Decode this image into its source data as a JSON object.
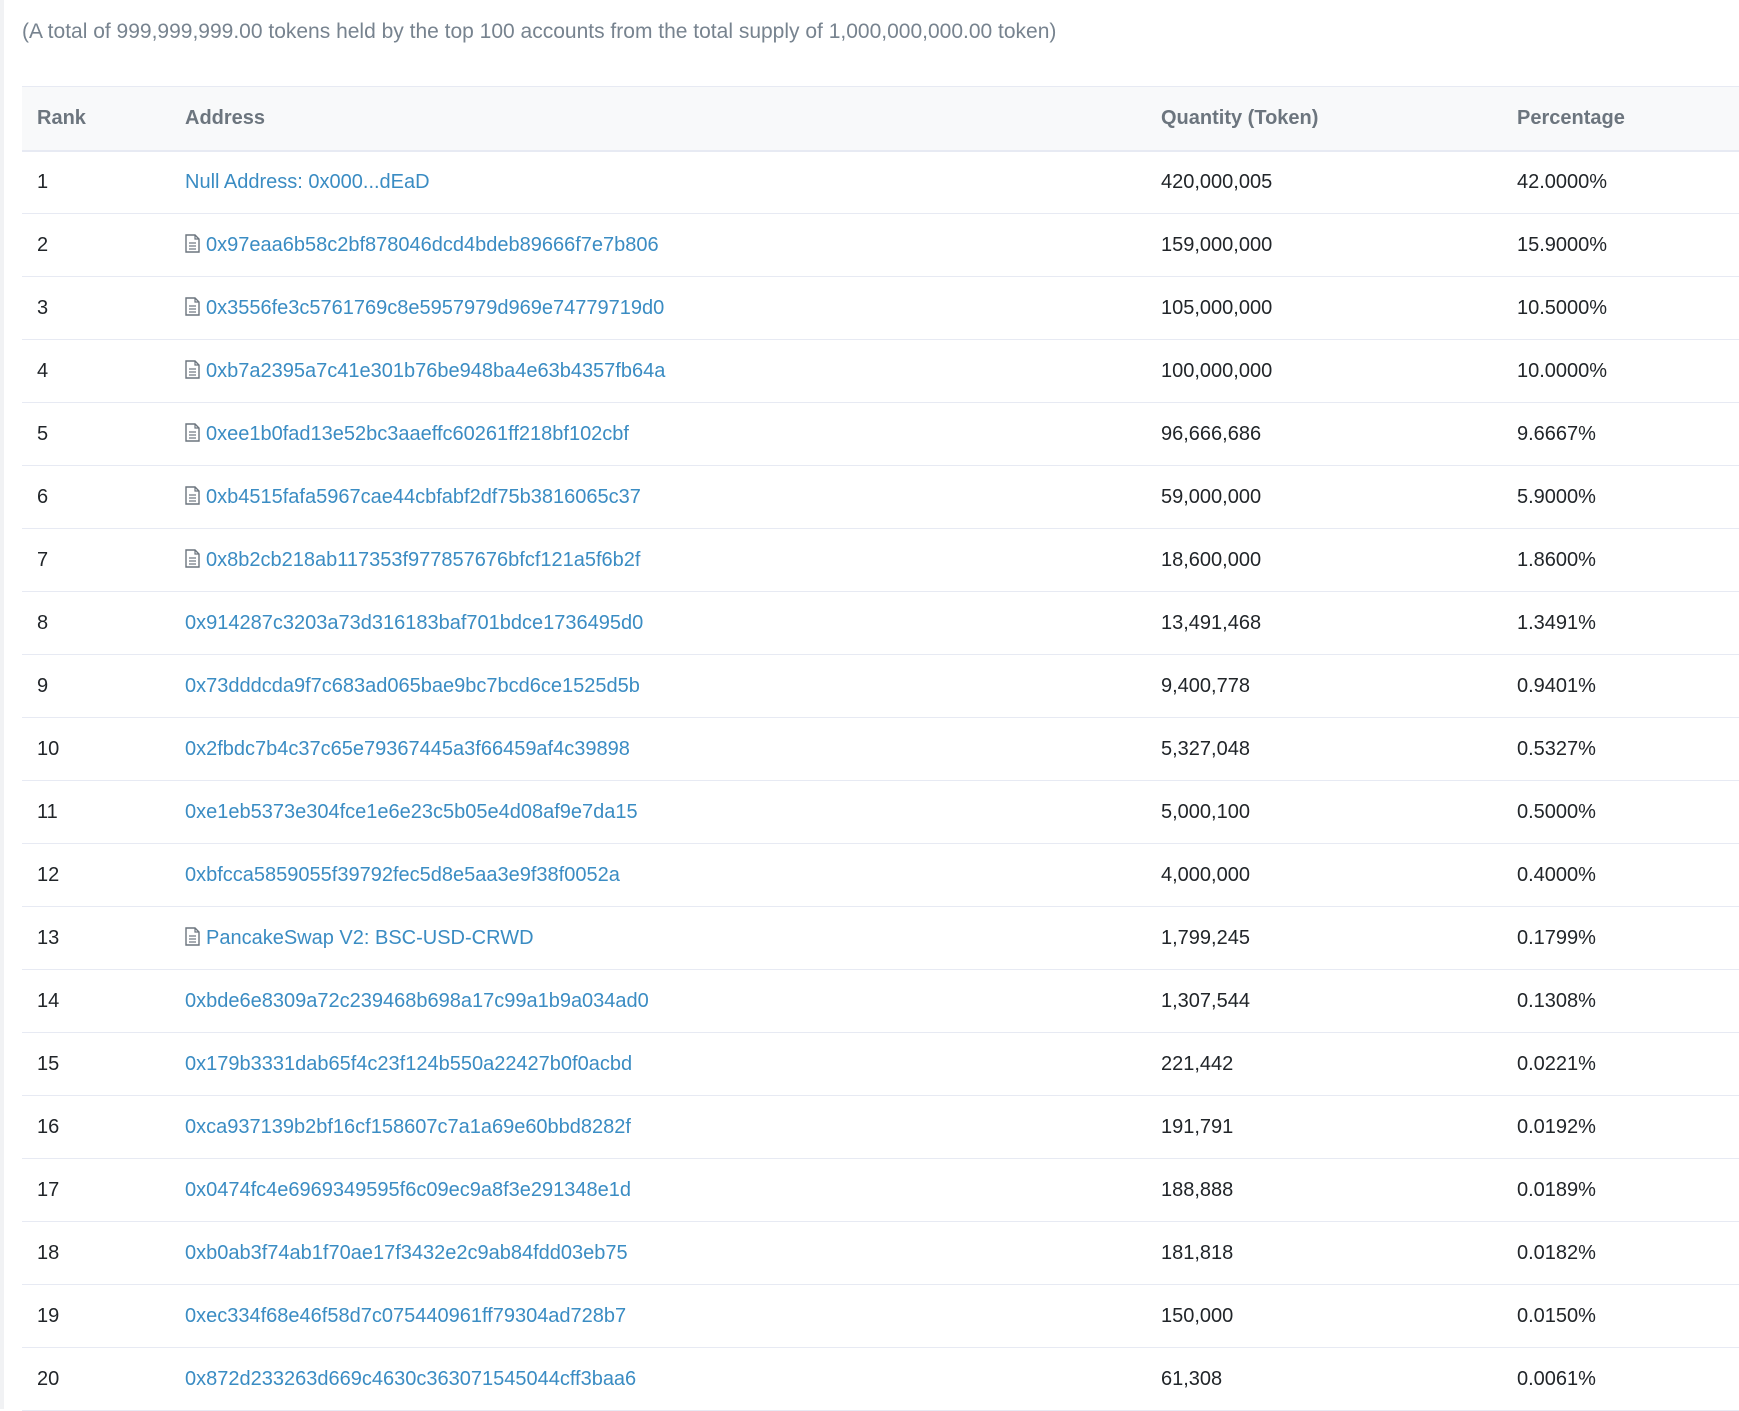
{
  "summary": "(A total of 999,999,999.00 tokens held by the top 100 accounts from the total supply of 1,000,000,000.00 token)",
  "table": {
    "headers": {
      "rank": "Rank",
      "address": "Address",
      "quantity": "Quantity (Token)",
      "percentage": "Percentage"
    },
    "rows": [
      {
        "rank": "1",
        "address": "Null Address: 0x000...dEaD",
        "contract": false,
        "quantity": "420,000,005",
        "percentage": "42.0000%"
      },
      {
        "rank": "2",
        "address": "0x97eaa6b58c2bf878046dcd4bdeb89666f7e7b806",
        "contract": true,
        "quantity": "159,000,000",
        "percentage": "15.9000%"
      },
      {
        "rank": "3",
        "address": "0x3556fe3c5761769c8e5957979d969e74779719d0",
        "contract": true,
        "quantity": "105,000,000",
        "percentage": "10.5000%"
      },
      {
        "rank": "4",
        "address": "0xb7a2395a7c41e301b76be948ba4e63b4357fb64a",
        "contract": true,
        "quantity": "100,000,000",
        "percentage": "10.0000%"
      },
      {
        "rank": "5",
        "address": "0xee1b0fad13e52bc3aaeffc60261ff218bf102cbf",
        "contract": true,
        "quantity": "96,666,686",
        "percentage": "9.6667%"
      },
      {
        "rank": "6",
        "address": "0xb4515fafa5967cae44cbfabf2df75b3816065c37",
        "contract": true,
        "quantity": "59,000,000",
        "percentage": "5.9000%"
      },
      {
        "rank": "7",
        "address": "0x8b2cb218ab117353f977857676bfcf121a5f6b2f",
        "contract": true,
        "quantity": "18,600,000",
        "percentage": "1.8600%"
      },
      {
        "rank": "8",
        "address": "0x914287c3203a73d316183baf701bdce1736495d0",
        "contract": false,
        "quantity": "13,491,468",
        "percentage": "1.3491%"
      },
      {
        "rank": "9",
        "address": "0x73dddcda9f7c683ad065bae9bc7bcd6ce1525d5b",
        "contract": false,
        "quantity": "9,400,778",
        "percentage": "0.9401%"
      },
      {
        "rank": "10",
        "address": "0x2fbdc7b4c37c65e79367445a3f66459af4c39898",
        "contract": false,
        "quantity": "5,327,048",
        "percentage": "0.5327%"
      },
      {
        "rank": "11",
        "address": "0xe1eb5373e304fce1e6e23c5b05e4d08af9e7da15",
        "contract": false,
        "quantity": "5,000,100",
        "percentage": "0.5000%"
      },
      {
        "rank": "12",
        "address": "0xbfcca5859055f39792fec5d8e5aa3e9f38f0052a",
        "contract": false,
        "quantity": "4,000,000",
        "percentage": "0.4000%"
      },
      {
        "rank": "13",
        "address": "PancakeSwap V2: BSC-USD-CRWD",
        "contract": true,
        "quantity": "1,799,245",
        "percentage": "0.1799%"
      },
      {
        "rank": "14",
        "address": "0xbde6e8309a72c239468b698a17c99a1b9a034ad0",
        "contract": false,
        "quantity": "1,307,544",
        "percentage": "0.1308%"
      },
      {
        "rank": "15",
        "address": "0x179b3331dab65f4c23f124b550a22427b0f0acbd",
        "contract": false,
        "quantity": "221,442",
        "percentage": "0.0221%"
      },
      {
        "rank": "16",
        "address": "0xca937139b2bf16cf158607c7a1a69e60bbd8282f",
        "contract": false,
        "quantity": "191,791",
        "percentage": "0.0192%"
      },
      {
        "rank": "17",
        "address": "0x0474fc4e6969349595f6c09ec9a8f3e291348e1d",
        "contract": false,
        "quantity": "188,888",
        "percentage": "0.0189%"
      },
      {
        "rank": "18",
        "address": "0xb0ab3f74ab1f70ae17f3432e2c9ab84fdd03eb75",
        "contract": false,
        "quantity": "181,818",
        "percentage": "0.0182%"
      },
      {
        "rank": "19",
        "address": "0xec334f68e46f58d7c075440961ff79304ad728b7",
        "contract": false,
        "quantity": "150,000",
        "percentage": "0.0150%"
      },
      {
        "rank": "20",
        "address": "0x872d233263d669c4630c363071545044cff3baa6",
        "contract": false,
        "quantity": "61,308",
        "percentage": "0.0061%"
      }
    ]
  },
  "icons": {
    "contract": "document-icon"
  },
  "colors": {
    "link": "#3a8cc3",
    "muted_text": "#77838f",
    "header_bg": "#f8f9fa",
    "border": "#e7eaf3"
  }
}
